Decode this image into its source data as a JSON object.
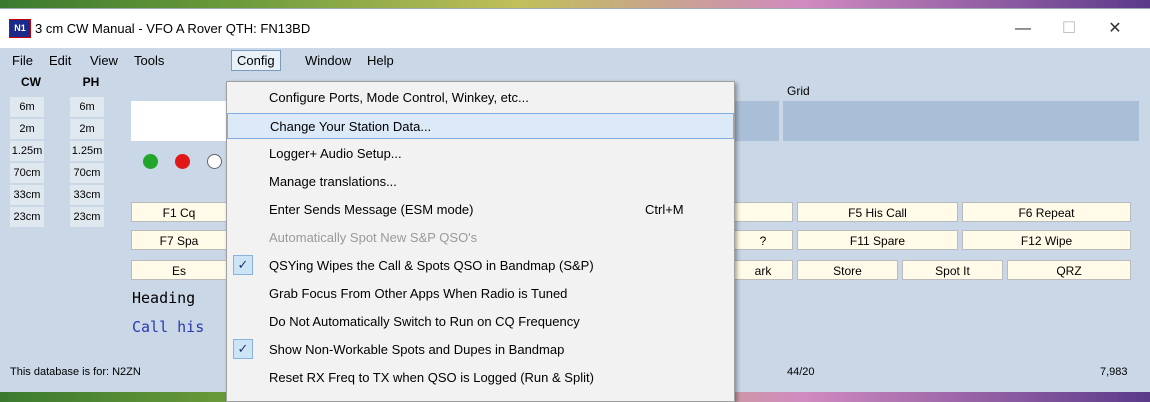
{
  "window": {
    "title": "3 cm CW Manual - VFO A   Rover QTH: FN13BD",
    "icon_text": "N1",
    "controls": {
      "minimize": "—",
      "maximize": "☐",
      "close": "✕"
    }
  },
  "menubar": [
    "File",
    "Edit",
    "View",
    "Tools",
    "Config",
    "Window",
    "Help"
  ],
  "bands": {
    "headers": [
      "CW",
      "PH"
    ],
    "cw": [
      "6m",
      "2m",
      "1.25m",
      "70cm",
      "33cm",
      "23cm"
    ],
    "ph": [
      "6m",
      "2m",
      "1.25m",
      "70cm",
      "33cm",
      "23cm"
    ]
  },
  "grid_label": "Grid",
  "colors": {
    "green": "#21a52b",
    "red": "#e01818"
  },
  "function_keys": {
    "row1": [
      "F1 Cq",
      "",
      "F5 His Call",
      "F6 Repeat"
    ],
    "row2": [
      "F7 Spa",
      "?",
      "F11 Spare",
      "F12 Wipe"
    ],
    "row3": [
      "Es",
      "ark",
      "Store",
      "Spot It",
      "QRZ"
    ]
  },
  "entry": {
    "heading": "Heading",
    "callhis": "Call his"
  },
  "status": {
    "left": "This database is for: N2ZN",
    "mid": "44/20",
    "right": "7,983"
  },
  "config_menu": [
    {
      "label": "Configure Ports, Mode Control, Winkey, etc...",
      "shortcut": "",
      "checked": false,
      "disabled": false,
      "hl": false
    },
    {
      "label": "Change Your Station Data...",
      "shortcut": "",
      "checked": false,
      "disabled": false,
      "hl": true
    },
    {
      "label": "Logger+ Audio Setup...",
      "shortcut": "",
      "checked": false,
      "disabled": false,
      "hl": false
    },
    {
      "label": "Manage translations...",
      "shortcut": "",
      "checked": false,
      "disabled": false,
      "hl": false
    },
    {
      "label": "Enter Sends Message (ESM mode)",
      "shortcut": "Ctrl+M",
      "checked": false,
      "disabled": false,
      "hl": false
    },
    {
      "label": "Automatically Spot New S&P QSO's",
      "shortcut": "",
      "checked": false,
      "disabled": true,
      "hl": false
    },
    {
      "label": "QSYing Wipes the Call & Spots QSO in Bandmap (S&P)",
      "shortcut": "",
      "checked": true,
      "disabled": false,
      "hl": false
    },
    {
      "label": "Grab Focus From Other Apps When Radio is Tuned",
      "shortcut": "",
      "checked": false,
      "disabled": false,
      "hl": false
    },
    {
      "label": "Do Not Automatically Switch to Run on CQ Frequency",
      "shortcut": "",
      "checked": false,
      "disabled": false,
      "hl": false
    },
    {
      "label": "Show Non-Workable Spots and Dupes in Bandmap",
      "shortcut": "",
      "checked": true,
      "disabled": false,
      "hl": false
    },
    {
      "label": "Reset RX Freq to TX when QSO is Logged (Run & Split)",
      "shortcut": "",
      "checked": false,
      "disabled": false,
      "hl": false
    }
  ]
}
